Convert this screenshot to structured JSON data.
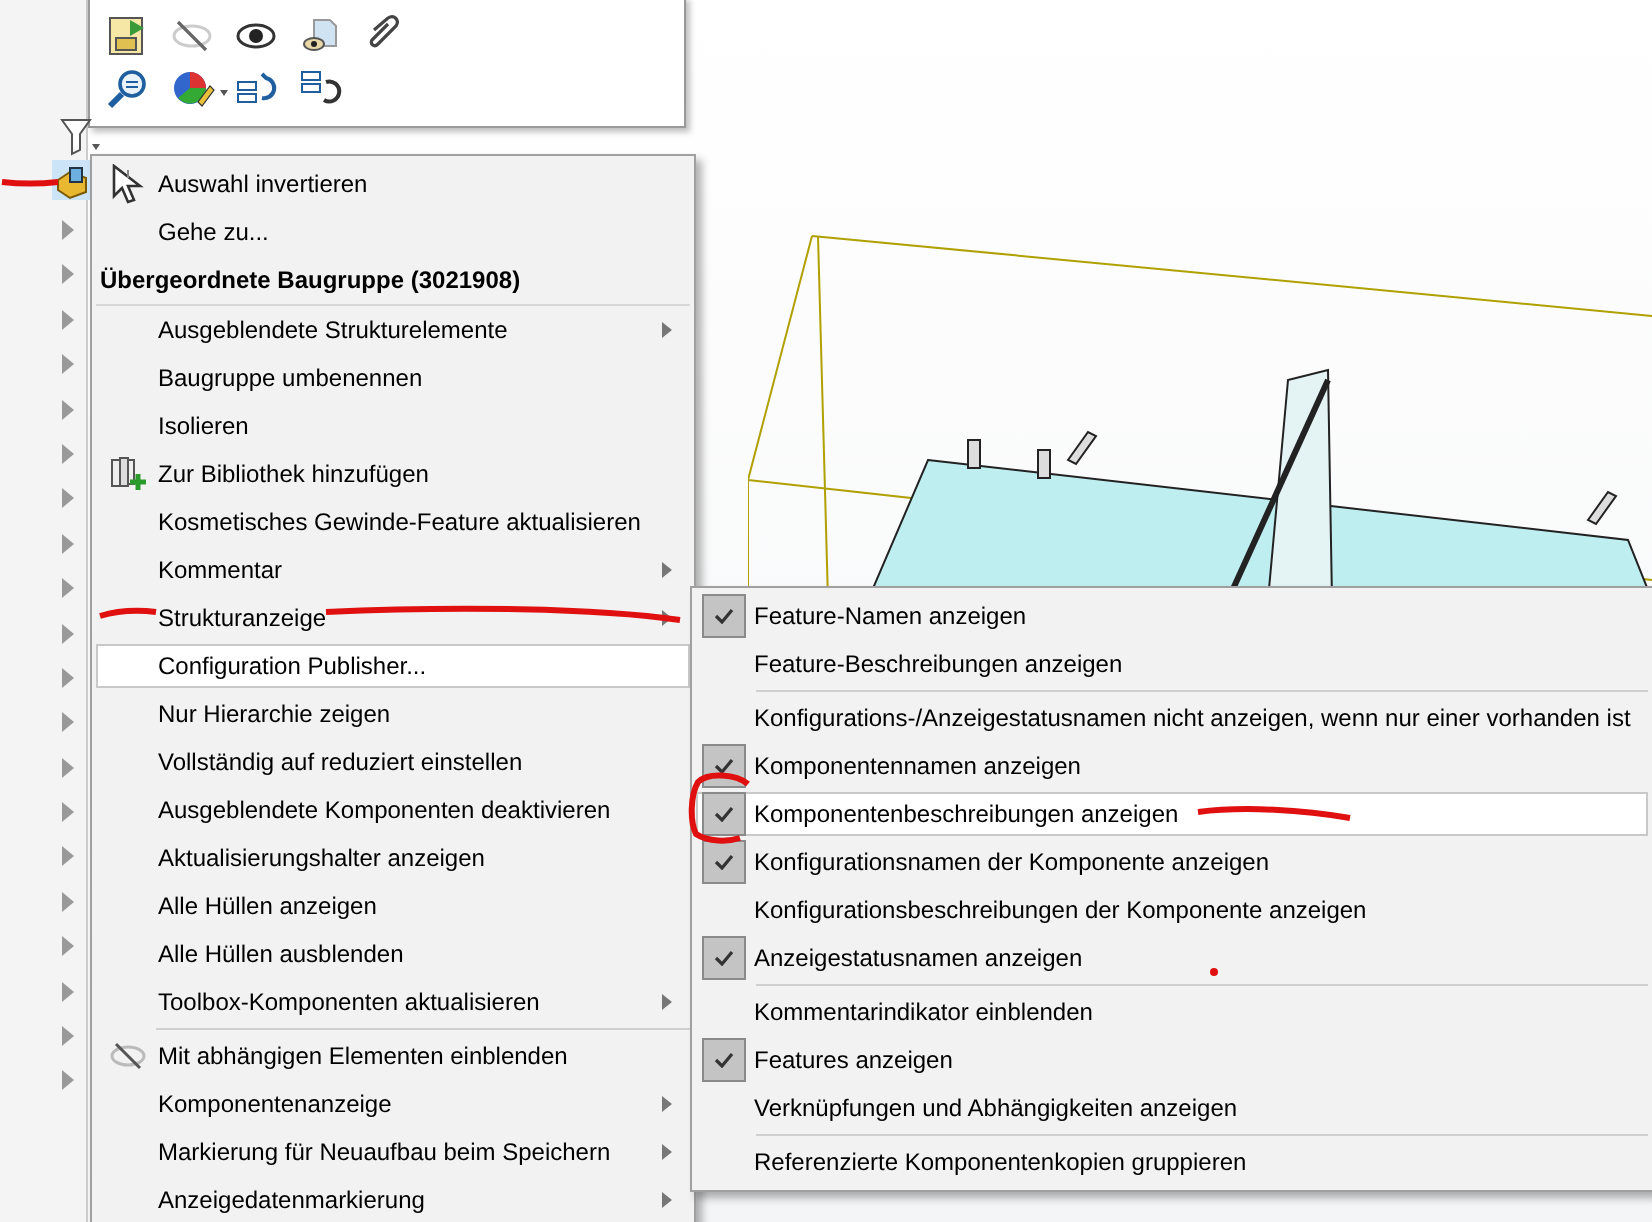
{
  "context_menu": {
    "items": [
      {
        "kind": "item",
        "label": "Auswahl invertieren",
        "submenu": false,
        "highlighted": false
      },
      {
        "kind": "item",
        "label": "Gehe zu...",
        "submenu": false,
        "highlighted": false
      },
      {
        "kind": "header",
        "label": "Übergeordnete Baugruppe (3021908)"
      },
      {
        "kind": "item",
        "label": "Ausgeblendete Strukturelemente",
        "submenu": true,
        "highlighted": false
      },
      {
        "kind": "item",
        "label": "Baugruppe umbenennen",
        "submenu": false,
        "highlighted": false
      },
      {
        "kind": "item",
        "label": "Isolieren",
        "submenu": false,
        "highlighted": false
      },
      {
        "kind": "item",
        "label": "Zur Bibliothek hinzufügen",
        "submenu": false,
        "highlighted": false
      },
      {
        "kind": "item",
        "label": "Kosmetisches Gewinde-Feature aktualisieren",
        "submenu": false,
        "highlighted": false
      },
      {
        "kind": "item",
        "label": "Kommentar",
        "submenu": true,
        "highlighted": false
      },
      {
        "kind": "item",
        "label": "Strukturanzeige",
        "submenu": true,
        "highlighted": false
      },
      {
        "kind": "item",
        "label": "Configuration Publisher...",
        "submenu": false,
        "highlighted": true
      },
      {
        "kind": "item",
        "label": "Nur Hierarchie zeigen",
        "submenu": false,
        "highlighted": false
      },
      {
        "kind": "item",
        "label": "Vollständig auf reduziert einstellen",
        "submenu": false,
        "highlighted": false
      },
      {
        "kind": "item",
        "label": "Ausgeblendete Komponenten deaktivieren",
        "submenu": false,
        "highlighted": false
      },
      {
        "kind": "item",
        "label": "Aktualisierungshalter anzeigen",
        "submenu": false,
        "highlighted": false
      },
      {
        "kind": "item",
        "label": "Alle Hüllen anzeigen",
        "submenu": false,
        "highlighted": false
      },
      {
        "kind": "item",
        "label": "Alle Hüllen ausblenden",
        "submenu": false,
        "highlighted": false
      },
      {
        "kind": "item",
        "label": "Toolbox-Komponenten aktualisieren",
        "submenu": true,
        "highlighted": false
      },
      {
        "kind": "separator"
      },
      {
        "kind": "item",
        "label": "Mit abhängigen Elementen einblenden",
        "submenu": false,
        "highlighted": false
      },
      {
        "kind": "item",
        "label": "Komponentenanzeige",
        "submenu": true,
        "highlighted": false
      },
      {
        "kind": "item",
        "label": "Markierung für Neuaufbau beim Speichern",
        "submenu": true,
        "highlighted": false
      },
      {
        "kind": "item",
        "label": "Anzeigedatenmarkierung",
        "submenu": true,
        "highlighted": false
      }
    ]
  },
  "submenu": {
    "items": [
      {
        "kind": "item",
        "label": "Feature-Namen anzeigen",
        "checked": true,
        "highlighted": false
      },
      {
        "kind": "item",
        "label": "Feature-Beschreibungen anzeigen",
        "checked": false,
        "highlighted": false
      },
      {
        "kind": "separator"
      },
      {
        "kind": "item",
        "label": "Konfigurations-/Anzeigestatusnamen nicht anzeigen, wenn nur einer vorhanden ist",
        "checked": false,
        "highlighted": false
      },
      {
        "kind": "item",
        "label": "Komponentennamen anzeigen",
        "checked": true,
        "highlighted": false
      },
      {
        "kind": "item",
        "label": "Komponentenbeschreibungen anzeigen",
        "checked": true,
        "highlighted": true
      },
      {
        "kind": "item",
        "label": "Konfigurationsnamen der Komponente anzeigen",
        "checked": true,
        "highlighted": false
      },
      {
        "kind": "item",
        "label": "Konfigurationsbeschreibungen der Komponente anzeigen",
        "checked": false,
        "highlighted": false
      },
      {
        "kind": "item",
        "label": "Anzeigestatusnamen anzeigen",
        "checked": true,
        "highlighted": false
      },
      {
        "kind": "separator"
      },
      {
        "kind": "item",
        "label": "Kommentarindikator einblenden",
        "checked": false,
        "highlighted": false
      },
      {
        "kind": "item",
        "label": "Features anzeigen",
        "checked": true,
        "highlighted": false
      },
      {
        "kind": "item",
        "label": "Verknüpfungen und Abhängigkeiten anzeigen",
        "checked": false,
        "highlighted": false
      },
      {
        "kind": "separator"
      },
      {
        "kind": "item",
        "label": "Referenzierte Komponentenkopien gruppieren",
        "checked": false,
        "highlighted": false
      }
    ]
  }
}
